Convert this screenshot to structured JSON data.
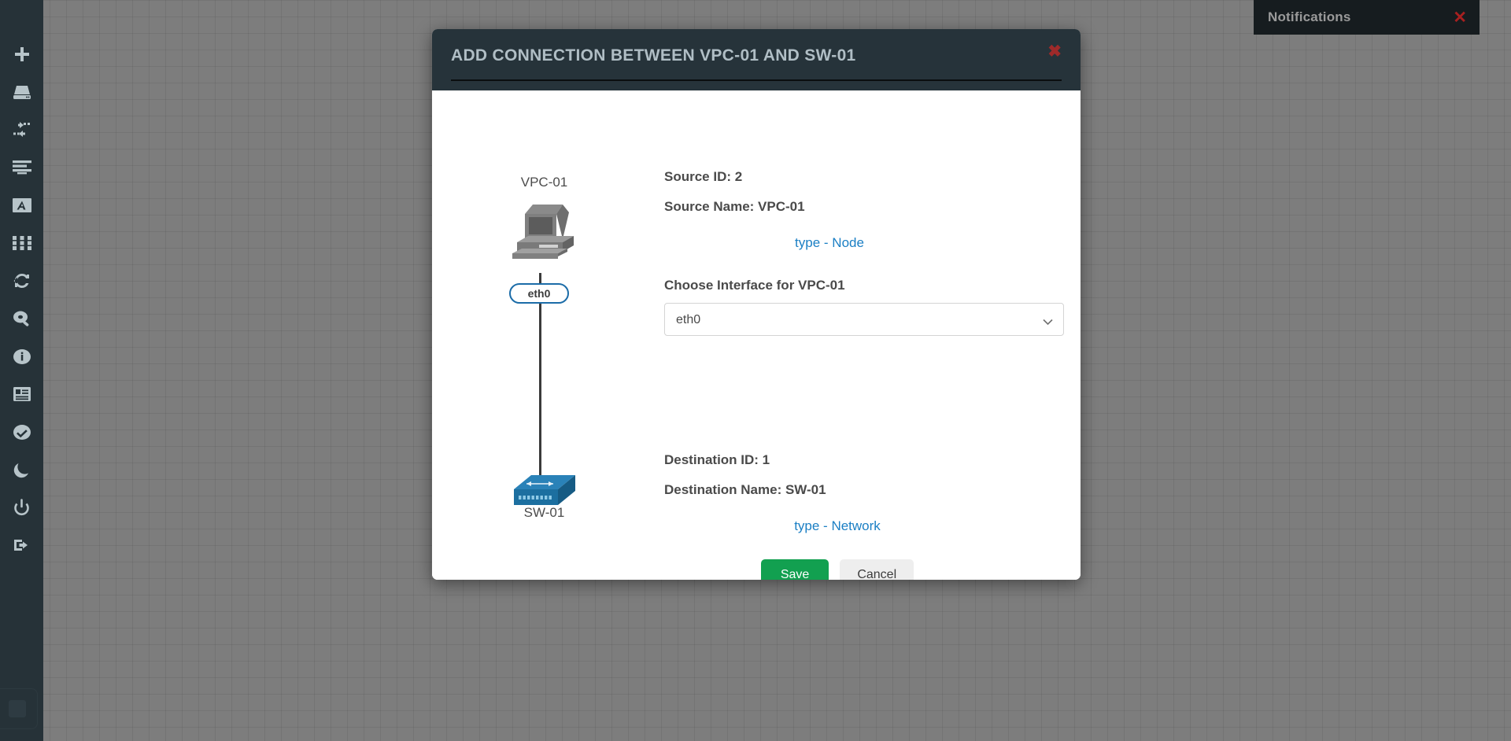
{
  "sidebar": {
    "items": [
      {
        "name": "add-icon",
        "label": "Add"
      },
      {
        "name": "device-icon",
        "label": "Device"
      },
      {
        "name": "connection-icon",
        "label": "Connection"
      },
      {
        "name": "list-icon",
        "label": "List"
      },
      {
        "name": "text-icon",
        "label": "Text"
      },
      {
        "name": "grid-icon",
        "label": "Grid"
      },
      {
        "name": "refresh-icon",
        "label": "Refresh"
      },
      {
        "name": "search-icon",
        "label": "Search"
      },
      {
        "name": "info-icon",
        "label": "Info"
      },
      {
        "name": "log-icon",
        "label": "Log"
      },
      {
        "name": "check-icon",
        "label": "Check"
      },
      {
        "name": "moon-icon",
        "label": "Dark mode"
      },
      {
        "name": "power-icon",
        "label": "Power"
      },
      {
        "name": "logout-icon",
        "label": "Logout"
      }
    ]
  },
  "notifications": {
    "title": "Notifications",
    "close_label": "✕"
  },
  "modal": {
    "title": "Add connection between VPC-01 and SW-01",
    "close_label": "✖",
    "topology": {
      "source_label": "VPC-01",
      "source_icon": "desktop-computer-icon",
      "interface_badge": "eth0",
      "destination_label": "SW-01",
      "destination_icon": "network-switch-icon"
    },
    "source": {
      "id_line": "Source ID: 2",
      "name_line": "Source Name: VPC-01",
      "type_link": "type - Node"
    },
    "interface": {
      "label": "Choose Interface for VPC-01",
      "value": "eth0",
      "options": [
        "eth0"
      ]
    },
    "destination": {
      "id_line": "Destination ID: 1",
      "name_line": "Destination Name: SW-01",
      "type_link": "type - Network"
    },
    "actions": {
      "save_label": "Save",
      "cancel_label": "Cancel"
    }
  },
  "colors": {
    "sidebar_bg": "#263238",
    "modal_header_bg": "#26333a",
    "canvas_bg": "#7d7d7d",
    "link_blue": "#1b7fc4",
    "save_green": "#12a050",
    "close_red": "#9e2a2a"
  }
}
